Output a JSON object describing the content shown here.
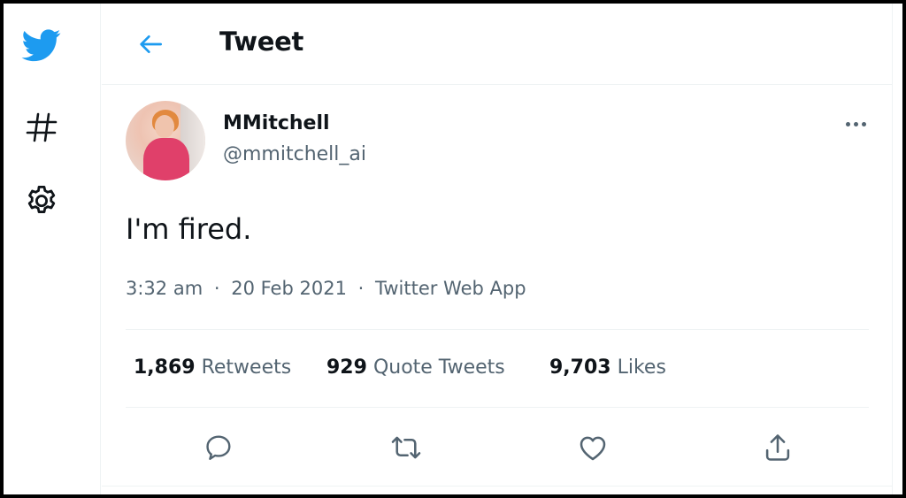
{
  "colors": {
    "brand": "#1d9bf0",
    "text": "#0f1419",
    "secondary": "#536471",
    "divider": "#eff3f4"
  },
  "rail": {
    "items": [
      {
        "icon": "twitter-bird-icon"
      },
      {
        "icon": "hashtag-icon"
      },
      {
        "icon": "gear-icon"
      }
    ]
  },
  "header": {
    "back_icon": "arrow-left-icon",
    "title": "Tweet"
  },
  "tweet": {
    "author": {
      "display_name": "MMitchell",
      "handle": "@mmitchell_ai",
      "avatar_icon": "avatar-photo"
    },
    "more_icon": "more-dots-icon",
    "text": "I'm fired.",
    "time": "3:32 am",
    "separator": "·",
    "date": "20 Feb 2021",
    "source": "Twitter Web App",
    "stats": {
      "retweets": {
        "count": "1,869",
        "label": "Retweets"
      },
      "quote_tweets": {
        "count": "929",
        "label": "Quote Tweets"
      },
      "likes": {
        "count": "9,703",
        "label": "Likes"
      }
    },
    "actions": [
      {
        "icon": "reply-icon"
      },
      {
        "icon": "retweet-icon"
      },
      {
        "icon": "like-icon"
      },
      {
        "icon": "share-icon"
      }
    ]
  }
}
